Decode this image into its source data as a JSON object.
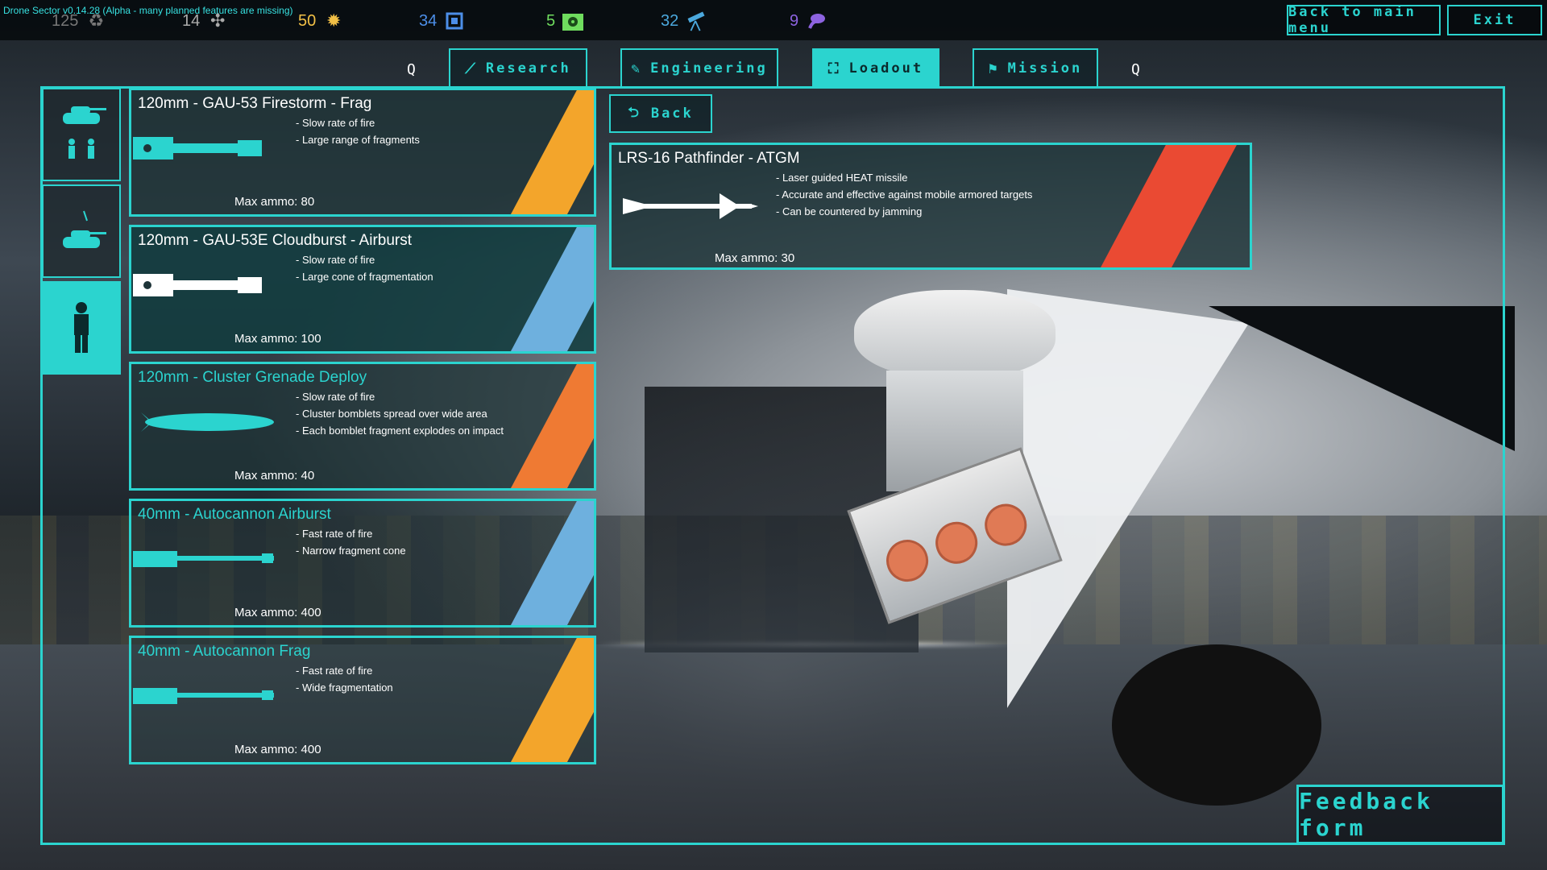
{
  "version_text": "Drone Sector v0.14.28 (Alpha - many planned features are missing)",
  "resources": [
    {
      "value": "125",
      "icon": "recycle-icon",
      "color": "#777777"
    },
    {
      "value": "14",
      "icon": "satellite-icon",
      "color": "#aaaaaa"
    },
    {
      "value": "50",
      "icon": "explosion-icon",
      "color": "#f2c046"
    },
    {
      "value": "34",
      "icon": "chip-icon",
      "color": "#4c8ee8"
    },
    {
      "value": "5",
      "icon": "radioactive-crate-icon",
      "color": "#6fdc5e"
    },
    {
      "value": "32",
      "icon": "telescope-icon",
      "color": "#4ba8dd"
    },
    {
      "value": "9",
      "icon": "alien-icon",
      "color": "#8d63e0"
    }
  ],
  "top_buttons": {
    "main_menu": "Back to main menu",
    "exit": "Exit"
  },
  "tabs": {
    "left_key": "Q",
    "right_key": "Q",
    "items": [
      {
        "label": "Research",
        "icon": "trend-icon",
        "active": false
      },
      {
        "label": "Engineering",
        "icon": "wrench-icon",
        "active": false
      },
      {
        "label": "Loadout",
        "icon": "bracket-icon",
        "active": true
      },
      {
        "label": "Mission",
        "icon": "flag-icon",
        "active": false
      }
    ]
  },
  "side_categories": [
    {
      "name": "tank-and-infantry",
      "active": false
    },
    {
      "name": "tank-with-missile",
      "active": false
    },
    {
      "name": "infantry",
      "active": true
    }
  ],
  "weapons": [
    {
      "name": "120mm - GAU-53 Firestorm - Frag",
      "name_color": "#ffffff",
      "features": [
        "- Slow rate of fire",
        "- Large range of fragments"
      ],
      "ammo": "Max ammo: 80",
      "stripe": "yellow",
      "icon": "cannon-frag-icon"
    },
    {
      "name": "120mm - GAU-53E Cloudburst - Airburst",
      "name_color": "#ffffff",
      "features": [
        "- Slow rate of fire",
        "- Large cone of fragmentation"
      ],
      "ammo": "Max ammo: 100",
      "stripe": "blue",
      "icon": "cannon-airburst-icon"
    },
    {
      "name": "120mm - Cluster Grenade Deploy",
      "name_color": "#2bd4cf",
      "features": [
        "- Slow rate of fire",
        "- Cluster bomblets spread over wide area",
        "- Each bomblet fragment explodes on impact"
      ],
      "ammo": "Max ammo: 40",
      "stripe": "orange",
      "icon": "cluster-grenade-icon"
    },
    {
      "name": "40mm - Autocannon Airburst",
      "name_color": "#2bd4cf",
      "features": [
        "- Fast rate of fire",
        "- Narrow fragment cone"
      ],
      "ammo": "Max ammo: 400",
      "stripe": "blue",
      "icon": "autocannon-airburst-icon"
    },
    {
      "name": "40mm - Autocannon Frag",
      "name_color": "#2bd4cf",
      "features": [
        "- Fast rate of fire",
        "- Wide fragmentation"
      ],
      "ammo": "Max ammo: 400",
      "stripe": "yellow",
      "icon": "autocannon-frag-icon"
    }
  ],
  "back_label": "Back",
  "selected": {
    "name": "LRS-16 Pathfinder - ATGM",
    "features": [
      "- Laser guided HEAT missile",
      "- Accurate and effective against mobile armored targets",
      "- Can be countered by jamming"
    ],
    "ammo": "Max ammo: 30",
    "icon": "missile-icon"
  },
  "feedback_label": "Feedback form"
}
